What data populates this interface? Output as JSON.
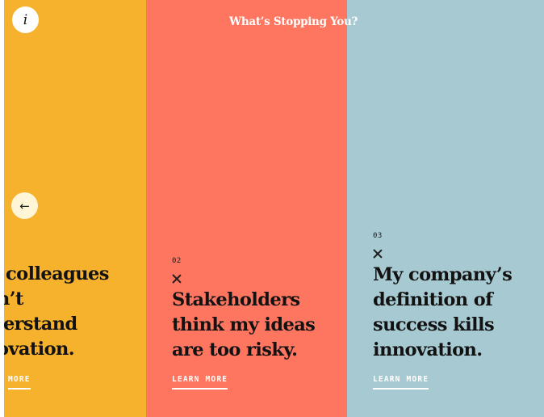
{
  "page": {
    "title": "What’s Stopping You?",
    "info_icon": "info-icon",
    "info_glyph": "i",
    "back_icon": "arrow-left-icon",
    "back_glyph": "←"
  },
  "panels": [
    {
      "color": "#f6b22d",
      "number": "",
      "headline_lines": [
        "colleagues",
        "n’t",
        "lerstand",
        "ovation."
      ],
      "link": "MORE"
    },
    {
      "color": "#ff7660",
      "number": "02",
      "headline_lines": [
        "Stakeholders",
        "think my ideas",
        "are too risky."
      ],
      "link": "LEARN MORE"
    },
    {
      "color": "#a7c9d1",
      "number": "03",
      "headline_lines": [
        "My company’s",
        "definition of",
        "success kills",
        "innovation."
      ],
      "link": "LEARN MORE"
    }
  ]
}
